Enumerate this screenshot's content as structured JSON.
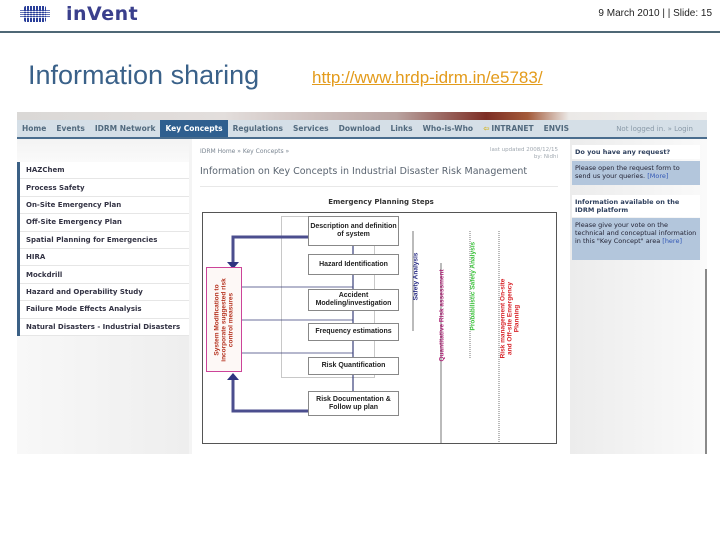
{
  "slide": {
    "logo_text": "inVent",
    "meta": "9 March 2010 |  | Slide: 15",
    "title": "Information sharing",
    "link": "http://www.hrdp-idrm.in/e5783/"
  },
  "site": {
    "nav": [
      {
        "label": "Home",
        "active": false
      },
      {
        "label": "Events",
        "active": false
      },
      {
        "label": "IDRM Network",
        "active": false
      },
      {
        "label": "Key Concepts",
        "active": true
      },
      {
        "label": "Regulations",
        "active": false
      },
      {
        "label": "Services",
        "active": false
      },
      {
        "label": "Download",
        "active": false
      },
      {
        "label": "Links",
        "active": false
      },
      {
        "label": "Who-is-Who",
        "active": false
      },
      {
        "label": "INTRANET",
        "active": false
      },
      {
        "label": "ENVIS",
        "active": false
      }
    ],
    "login_status": "Not logged in. » Login",
    "left_nav": [
      "HAZChem",
      "Process Safety",
      "On-Site Emergency Plan",
      "Off-Site Emergency Plan",
      "Spatial Planning for Emergencies",
      "HIRA",
      "Mockdrill",
      "Hazard and Operability Study",
      "Failure Mode Effects Analysis",
      "Natural Disasters - Industrial Disasters"
    ],
    "breadcrumb": "IDRM Home » Key Concepts »",
    "last_updated_line1": "last updated 2008/12/15",
    "last_updated_line2": "by: Nidhi",
    "content_title": "Information on Key Concepts in Industrial Disaster Risk Management",
    "diagram": {
      "title": "Emergency Planning Steps",
      "steps": [
        "Description and definition of system",
        "Hazard Identification",
        "Accident Modeling/investigation",
        "Frequency estimations",
        "Risk Quantification",
        "Risk Documentation & Follow up plan"
      ],
      "feedback_box": "System Modification to incorporate suggested risk control measures",
      "side_labels": {
        "safety_analysis": "Safety Analysis",
        "quantitative_risk": "Quantitative Risk assessment",
        "probabilistic": "Probabilistic Safety Analysis",
        "risk_management": "Risk management On-site and Off-site Emergency Planning"
      }
    },
    "right_boxes": [
      {
        "head": "Do you have any request?",
        "body": "Please open the request form to send us your queries.",
        "more": "[More]"
      },
      {
        "head": "Information available on the IDRM platform",
        "body": "Please give your vote on the technical and conceptual information in this \"Key Concept\" area",
        "more": "[here]"
      }
    ],
    "colors": {
      "nav_active": "#2f5f8f",
      "title_blue": "#3a6189",
      "link_orange": "#e39b1b",
      "safety_analysis": "#2b2f86",
      "quantitative": "#b0287a",
      "probabilistic": "#3cc23c",
      "risk_management": "#d8242a",
      "feedback_text": "#b5321f"
    }
  }
}
